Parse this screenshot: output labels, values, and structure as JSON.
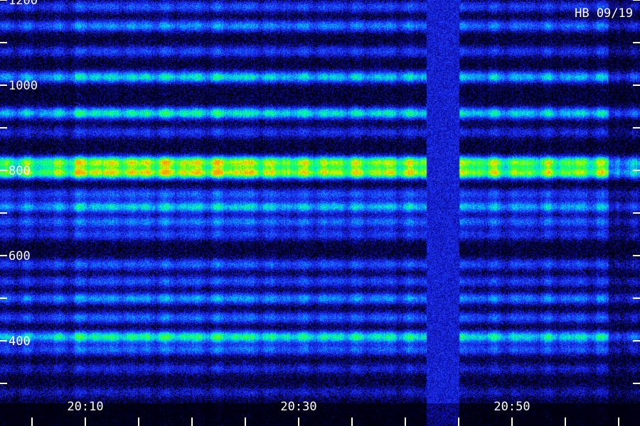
{
  "chart_data": {
    "type": "heatmap",
    "title": "",
    "annotation": "HB 09/19",
    "xlabel": "",
    "ylabel": "",
    "x_range": [
      "20:02",
      "21:02"
    ],
    "x_tick_labels": [
      {
        "value": "20:10",
        "label": "20:10"
      },
      {
        "value": "20:30",
        "label": "20:30"
      },
      {
        "value": "20:50",
        "label": "20:50"
      }
    ],
    "x_minor_step_minutes": 5,
    "ylim": [
      200,
      1200
    ],
    "y_tick_labels": [
      {
        "value": 400,
        "label": "400"
      },
      {
        "value": 600,
        "label": "600"
      },
      {
        "value": 800,
        "label": "800"
      },
      {
        "value": 1000,
        "label": "1000"
      },
      {
        "value": 1200,
        "label": "1200"
      }
    ],
    "y_minor_step": 100,
    "colorscale": [
      "#000000",
      "#1010c0",
      "#2040ff",
      "#00b0ff",
      "#00ffb0",
      "#30ff20",
      "#e0ff00",
      "#ffa000"
    ],
    "bands": [
      {
        "y": 1185,
        "intensity": 0.28
      },
      {
        "y": 1140,
        "intensity": 0.38
      },
      {
        "y": 1080,
        "intensity": 0.25
      },
      {
        "y": 1020,
        "intensity": 0.52
      },
      {
        "y": 935,
        "intensity": 0.58
      },
      {
        "y": 890,
        "intensity": 0.22
      },
      {
        "y": 820,
        "intensity": 0.88
      },
      {
        "y": 795,
        "intensity": 0.93
      },
      {
        "y": 745,
        "intensity": 0.3
      },
      {
        "y": 715,
        "intensity": 0.5
      },
      {
        "y": 680,
        "intensity": 0.35
      },
      {
        "y": 650,
        "intensity": 0.25
      },
      {
        "y": 580,
        "intensity": 0.3
      },
      {
        "y": 540,
        "intensity": 0.28
      },
      {
        "y": 500,
        "intensity": 0.4
      },
      {
        "y": 455,
        "intensity": 0.32
      },
      {
        "y": 410,
        "intensity": 0.62
      },
      {
        "y": 380,
        "intensity": 0.32
      },
      {
        "y": 335,
        "intensity": 0.18
      },
      {
        "y": 280,
        "intensity": 0.15
      }
    ],
    "dropout": {
      "start": "20:42",
      "end": "20:45"
    },
    "strong_period": {
      "start": "20:07",
      "end": "20:27"
    },
    "data_end": "20:59"
  }
}
